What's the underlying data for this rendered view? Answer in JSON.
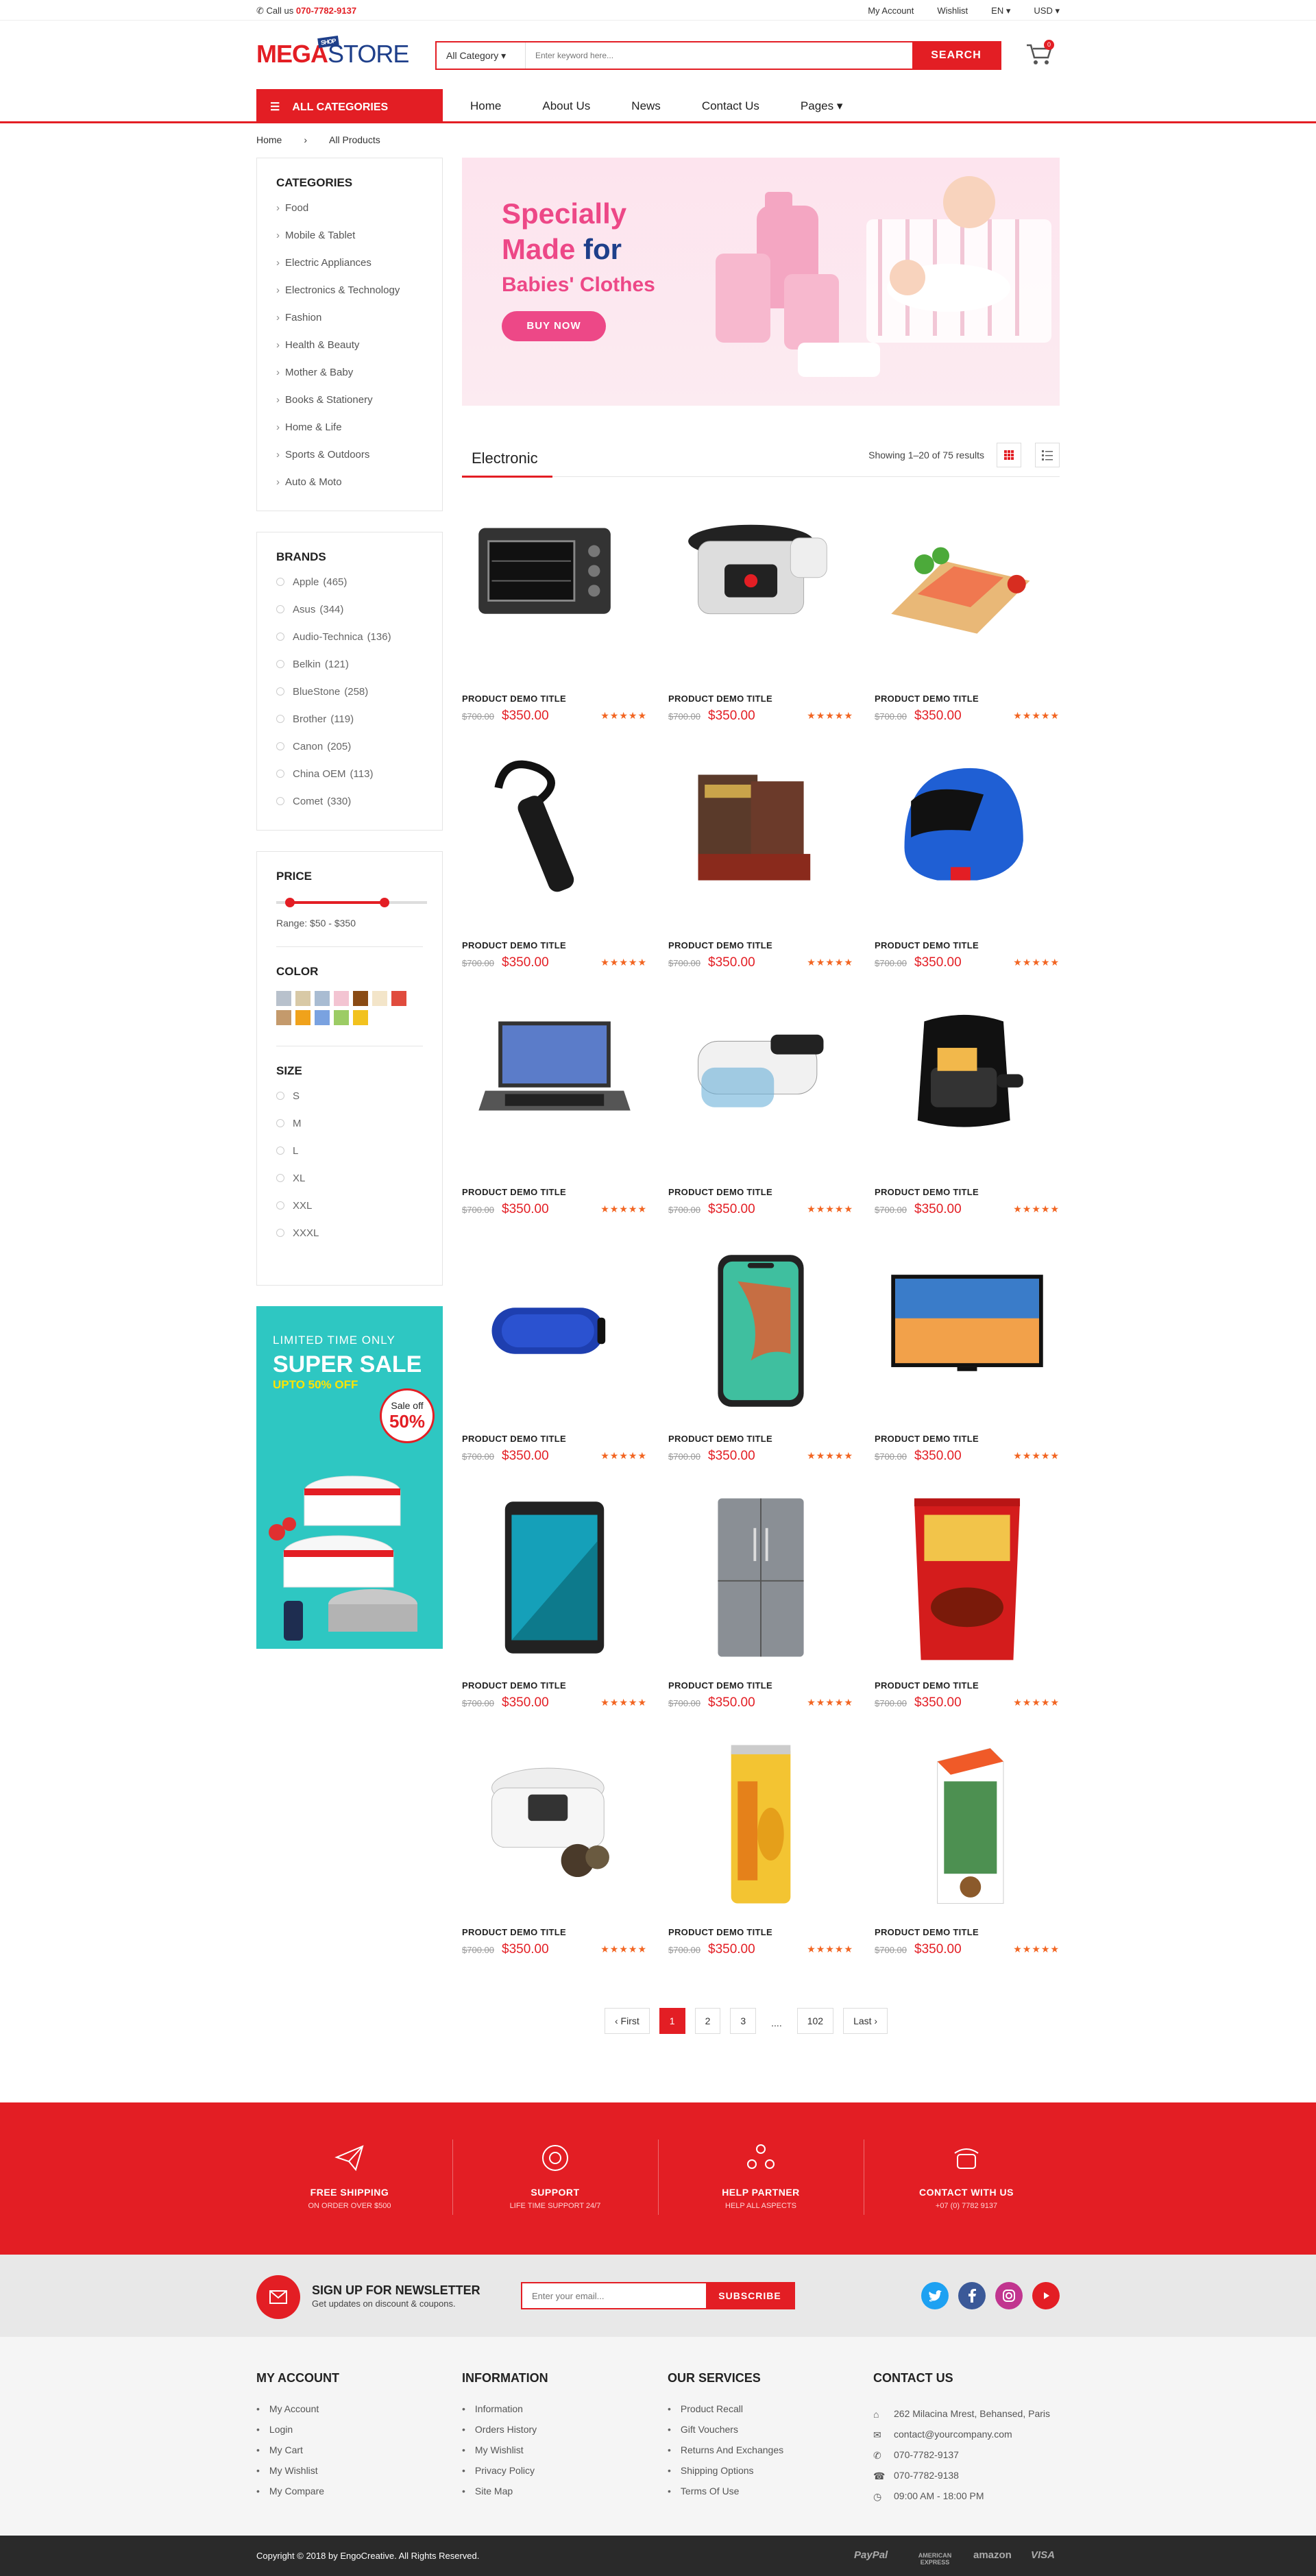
{
  "topbar": {
    "call_label": "Call us",
    "phone": "070-7782-9137",
    "links": [
      "My Account",
      "Wishlist",
      "EN",
      "USD"
    ]
  },
  "header": {
    "logo_mega": "MEGA",
    "logo_tag": "SHOP",
    "logo_store": "STORE",
    "category_select": "All Category",
    "search_placeholder": "Enter keyword here...",
    "search_button": "SEARCH",
    "cart_count": "0"
  },
  "nav": {
    "all_categories": "ALL CATEGORIES",
    "links": [
      "Home",
      "About Us",
      "News",
      "Contact Us",
      "Pages"
    ]
  },
  "breadcrumb": [
    "Home",
    "All Products"
  ],
  "sidebar": {
    "categories_title": "CATEGORIES",
    "categories": [
      "Food",
      "Mobile & Tablet",
      "Electric Appliances",
      "Electronics & Technology",
      "Fashion",
      "Health & Beauty",
      "Mother & Baby",
      "Books & Stationery",
      "Home & Life",
      "Sports & Outdoors",
      "Auto & Moto"
    ],
    "brands_title": "BRANDS",
    "brands": [
      {
        "name": "Apple",
        "count": "(465)"
      },
      {
        "name": "Asus",
        "count": "(344)"
      },
      {
        "name": "Audio-Technica",
        "count": "(136)"
      },
      {
        "name": "Belkin",
        "count": "(121)"
      },
      {
        "name": "BlueStone",
        "count": "(258)"
      },
      {
        "name": "Brother",
        "count": "(119)"
      },
      {
        "name": "Canon",
        "count": "(205)"
      },
      {
        "name": "China OEM",
        "count": "(113)"
      },
      {
        "name": "Comet",
        "count": "(330)"
      }
    ],
    "price_title": "PRICE",
    "price_range": "Range: $50 - $350",
    "price_min_fraction": 0.09,
    "price_max_fraction": 0.72,
    "color_title": "COLOR",
    "colors": [
      "#b8c1cc",
      "#d8c9a6",
      "#a9bcd2",
      "#f3c4d2",
      "#8a4b14",
      "#f3e5c9",
      "#e04b3d",
      "#c49a6c",
      "#f0a21b",
      "#7aa2e0",
      "#9ccc65",
      "#f2c21e"
    ],
    "size_title": "SIZE",
    "sizes": [
      "S",
      "M",
      "L",
      "XL",
      "XXL",
      "XXXL"
    ]
  },
  "promo": {
    "line1": "LIMITED TIME ONLY",
    "line2": "SUPER SALE",
    "line3": "UPTO 50% OFF",
    "badge_top": "Sale off",
    "badge_pct": "50%"
  },
  "banner": {
    "line1": "Specially",
    "line2a": "Made ",
    "line2b": "for",
    "line3": "Babies' Clothes",
    "button": "BUY NOW"
  },
  "products_section": {
    "title": "Electronic",
    "showing": "Showing 1–20 of 75 results"
  },
  "products": [
    {
      "icon": "toaster-oven",
      "name": "PRODUCT DEMO TITLE",
      "old": "$700.00",
      "price": "$350.00",
      "stars": "★★★★★"
    },
    {
      "icon": "pressure-cooker",
      "name": "PRODUCT DEMO TITLE",
      "old": "$700.00",
      "price": "$350.00",
      "stars": "★★★★★"
    },
    {
      "icon": "salmon",
      "name": "PRODUCT DEMO TITLE",
      "old": "$700.00",
      "price": "$350.00",
      "stars": "★★★★★"
    },
    {
      "icon": "bluetooth-headset",
      "name": "PRODUCT DEMO TITLE",
      "old": "$700.00",
      "price": "$350.00",
      "stars": "★★★★★"
    },
    {
      "icon": "books",
      "name": "PRODUCT DEMO TITLE",
      "old": "$700.00",
      "price": "$350.00",
      "stars": "★★★★★"
    },
    {
      "icon": "helmet",
      "name": "PRODUCT DEMO TITLE",
      "old": "$700.00",
      "price": "$350.00",
      "stars": "★★★★★"
    },
    {
      "icon": "laptop",
      "name": "PRODUCT DEMO TITLE",
      "old": "$700.00",
      "price": "$350.00",
      "stars": "★★★★★"
    },
    {
      "icon": "vr-headset",
      "name": "PRODUCT DEMO TITLE",
      "old": "$700.00",
      "price": "$350.00",
      "stars": "★★★★★"
    },
    {
      "icon": "air-fryer",
      "name": "PRODUCT DEMO TITLE",
      "old": "$700.00",
      "price": "$350.00",
      "stars": "★★★★★"
    },
    {
      "icon": "speaker",
      "name": "PRODUCT DEMO TITLE",
      "old": "$700.00",
      "price": "$350.00",
      "stars": "★★★★★"
    },
    {
      "icon": "smartphone",
      "name": "PRODUCT DEMO TITLE",
      "old": "$700.00",
      "price": "$350.00",
      "stars": "★★★★★"
    },
    {
      "icon": "tv",
      "name": "PRODUCT DEMO TITLE",
      "old": "$700.00",
      "price": "$350.00",
      "stars": "★★★★★"
    },
    {
      "icon": "tablet",
      "name": "PRODUCT DEMO TITLE",
      "old": "$700.00",
      "price": "$350.00",
      "stars": "★★★★★"
    },
    {
      "icon": "refrigerator",
      "name": "PRODUCT DEMO TITLE",
      "old": "$700.00",
      "price": "$350.00",
      "stars": "★★★★★"
    },
    {
      "icon": "snack-bag",
      "name": "PRODUCT DEMO TITLE",
      "old": "$700.00",
      "price": "$350.00",
      "stars": "★★★★★"
    },
    {
      "icon": "rice-cooker",
      "name": "PRODUCT DEMO TITLE",
      "old": "$700.00",
      "price": "$350.00",
      "stars": "★★★★★"
    },
    {
      "icon": "mango-can",
      "name": "PRODUCT DEMO TITLE",
      "old": "$700.00",
      "price": "$350.00",
      "stars": "★★★★★"
    },
    {
      "icon": "coconut-carton",
      "name": "PRODUCT DEMO TITLE",
      "old": "$700.00",
      "price": "$350.00",
      "stars": "★★★★★"
    }
  ],
  "pagination": [
    "‹ First",
    "1",
    "2",
    "3",
    "....",
    "102",
    "Last ›"
  ],
  "services": [
    {
      "title": "FREE SHIPPING",
      "sub": "ON ORDER OVER $500"
    },
    {
      "title": "SUPPORT",
      "sub": "LIFE TIME SUPPORT 24/7"
    },
    {
      "title": "HELP PARTNER",
      "sub": "HELP ALL ASPECTS"
    },
    {
      "title": "CONTACT WITH US",
      "sub": "+07 (0) 7782 9137"
    }
  ],
  "newsletter": {
    "title": "SIGN UP FOR NEWSLETTER",
    "sub": "Get updates on discount & coupons.",
    "placeholder": "Enter your email...",
    "button": "SUBSCRIBE"
  },
  "footer": {
    "account_title": "MY ACCOUNT",
    "account": [
      "My Account",
      "Login",
      "My Cart",
      "My Wishlist",
      "My Compare"
    ],
    "info_title": "INFORMATION",
    "info": [
      "Information",
      "Orders History",
      "My Wishlist",
      "Privacy Policy",
      "Site Map"
    ],
    "services_title": "OUR SERVICES",
    "services": [
      "Product Recall",
      "Gift Vouchers",
      "Returns And Exchanges",
      "Shipping Options",
      "Terms Of Use"
    ],
    "contact_title": "CONTACT US",
    "contact": [
      "262 Milacina Mrest, Behansed, Paris",
      "contact@yourcompany.com",
      "070-7782-9137",
      "070-7782-9138",
      "09:00 AM - 18:00 PM"
    ]
  },
  "bottom": {
    "copyright": "Copyright © 2018 by EngoCreative. All Rights Reserved.",
    "payments": [
      "PayPal",
      "AMERICAN EXPRESS",
      "amazon",
      "VISA"
    ]
  }
}
